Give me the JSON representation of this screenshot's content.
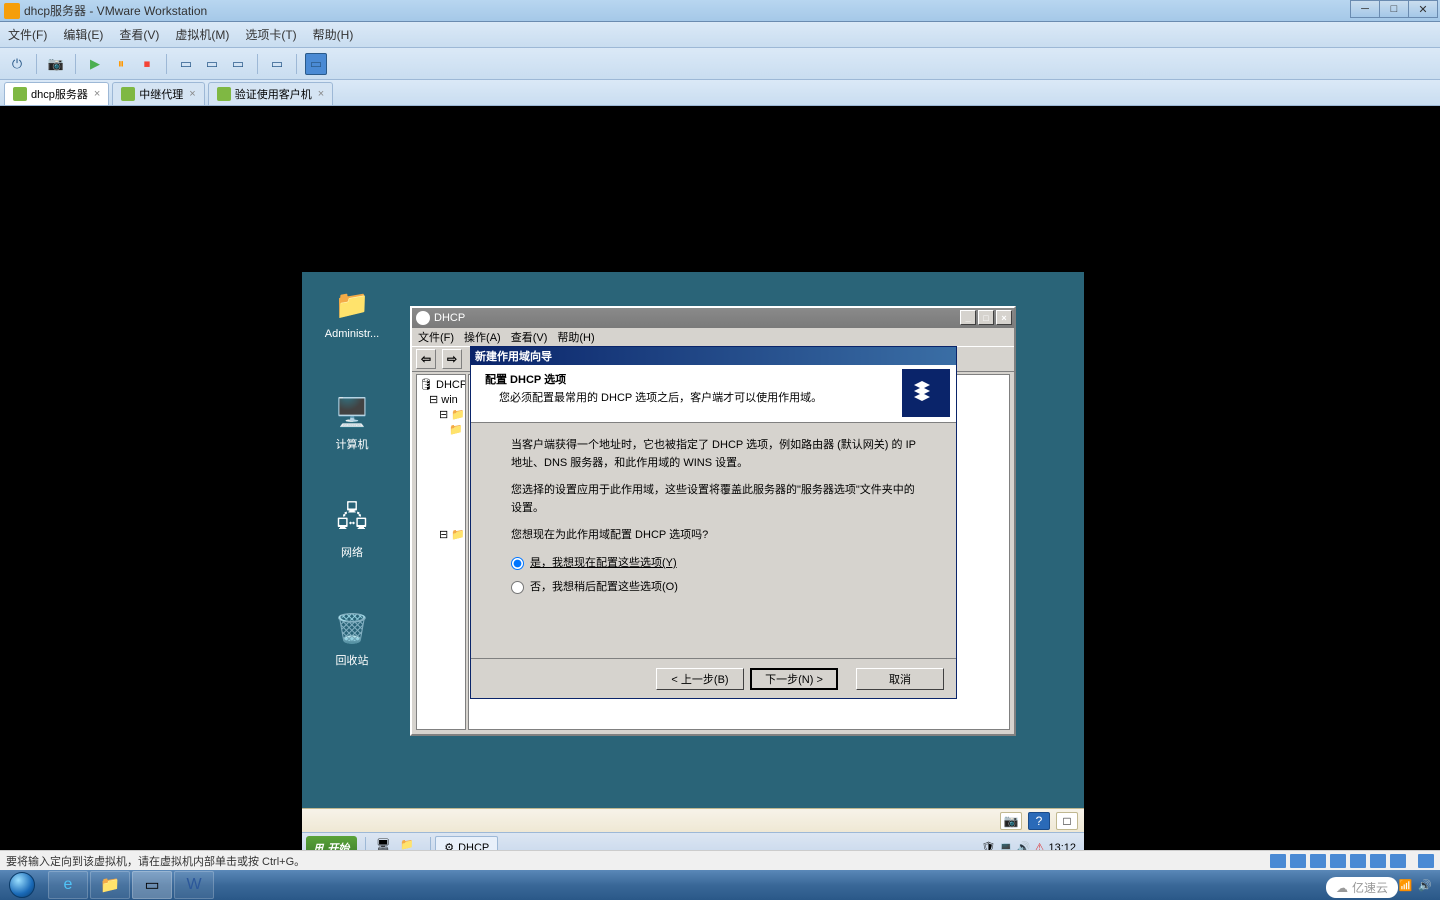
{
  "host": {
    "title": "dhcp服务器 - VMware Workstation",
    "menu": {
      "file": "文件(F)",
      "edit": "编辑(E)",
      "view": "查看(V)",
      "vm": "虚拟机(M)",
      "tabs": "选项卡(T)",
      "help": "帮助(H)"
    },
    "tabs": {
      "t1": "dhcp服务器",
      "t2": "中继代理",
      "t3": "验证使用客户机"
    },
    "status": "要将输入定向到该虚拟机，请在虚拟机内部单击或按 Ctrl+G。"
  },
  "guest": {
    "desktop": {
      "admin": "Administr...",
      "computer": "计算机",
      "network": "网络",
      "recycle": "回收站"
    },
    "mmc": {
      "title": "DHCP",
      "menu": {
        "file": "文件(F)",
        "action": "操作(A)",
        "view": "查看(V)",
        "help": "帮助(H)"
      },
      "tree": {
        "root": "DHCP",
        "server": "win"
      }
    },
    "wizard": {
      "title": "新建作用域向导",
      "heading": "配置 DHCP 选项",
      "subheading": "您必须配置最常用的 DHCP 选项之后，客户端才可以使用作用域。",
      "p1": "当客户端获得一个地址时，它也被指定了 DHCP 选项，例如路由器 (默认网关) 的 IP 地址、DNS 服务器，和此作用域的 WINS 设置。",
      "p2": "您选择的设置应用于此作用域，这些设置将覆盖此服务器的\"服务器选项\"文件夹中的设置。",
      "question": "您想现在为此作用域配置 DHCP 选项吗?",
      "opt_yes": "是，我想现在配置这些选项(Y)",
      "opt_no": "否，我想稍后配置这些选项(O)",
      "btn_back": "< 上一步(B)",
      "btn_next": "下一步(N) >",
      "btn_cancel": "取消"
    },
    "taskbar": {
      "start": "开始",
      "task1": "DHCP",
      "time": "13:12"
    }
  },
  "win7tray": {
    "watermark": "亿速云"
  }
}
